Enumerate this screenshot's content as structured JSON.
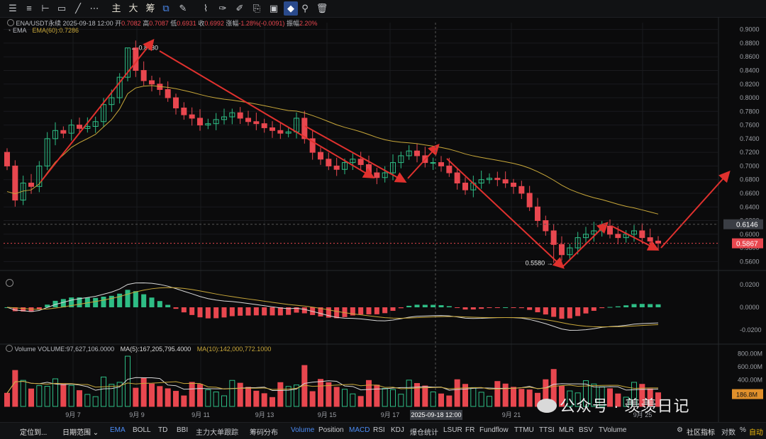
{
  "toolbar": {
    "text_tools": [
      "主",
      "大",
      "筹"
    ],
    "icons": [
      "layers-icon",
      "indicator-list-icon",
      "crosshair-icon",
      "rectangle-icon",
      "trendline-icon",
      "more-dots-icon",
      "main-chart-icon",
      "big-order-icon",
      "chips-icon",
      "compare-icon",
      "draw-icon",
      "ruler-icon",
      "brush-icon",
      "text-tool-icon",
      "copy-icon",
      "settings-icon",
      "magnet-icon",
      "filter-icon",
      "trash-icon"
    ]
  },
  "header": {
    "symbol": "ENA/USDT永续",
    "datetime": "2025-09-18 12:00",
    "open_label": "开",
    "open": "0.7082",
    "high_label": "高",
    "high": "0.7087",
    "low_label": "低",
    "low": "0.6931",
    "close_label": "收",
    "close": "0.6992",
    "change_label": "涨幅",
    "change": "-1.28%(-0.0091)",
    "amp_label": "振幅",
    "amp": "2.20%",
    "ema_title": "EMA",
    "ema_value": "EMA(60):0.7286"
  },
  "volume_legend": {
    "volume": "Volume",
    "volume_value": "VOLUME:97,627,106.0000",
    "ma5": "MA(5):167,205,795.4000",
    "ma10": "MA(10):142,000,772.1000"
  },
  "bottombar": {
    "left_btn": "定位到...",
    "range": "日期范围",
    "main_indicators": [
      "EMA",
      "BOLL",
      "TD",
      "BBI",
      "主力大单跟踪",
      "筹码分布"
    ],
    "sub_indicators": [
      "Volume",
      "Position",
      "MACD",
      "RSI",
      "KDJ",
      "爆仓统计",
      "LSUR",
      "FR",
      "Fundflow",
      "TTMU",
      "TTSI",
      "MLR",
      "BSV",
      "TVolume"
    ],
    "right_items": [
      "社区指标",
      "对数",
      "%",
      "自动"
    ]
  },
  "watermark": "公众号 · 羡羡日记",
  "colors": {
    "up": "#2ebd85",
    "down": "#e8474f",
    "ema": "#c9a83a",
    "arrow": "#e0312e",
    "macd_line": "#d9d9d9",
    "signal_line": "#c9a83a",
    "ma5": "#d9d9d9",
    "ma10": "#c9a83a",
    "accent": "#f0b90b"
  },
  "chart_data": {
    "type": "candlestick",
    "x_tick_labels": [
      "9月 7",
      "9月 9",
      "9月 11",
      "9月 13",
      "9月 15",
      "9月 17",
      "9月 21",
      "9月 25"
    ],
    "crosshair_x_label": "2025-09-18 12:00",
    "price_axis": {
      "min": 0.55,
      "max": 0.91,
      "ticks": [
        "0.9000",
        "0.8800",
        "0.8600",
        "0.8400",
        "0.8200",
        "0.8000",
        "0.7800",
        "0.7600",
        "0.7400",
        "0.7200",
        "0.7000",
        "0.6800",
        "0.6600",
        "0.6400",
        "0.6200",
        "0.6000",
        "0.5800",
        "0.5600"
      ]
    },
    "price_badges": {
      "crosshair": "0.6146",
      "last": "0.5867"
    },
    "annotations": {
      "high": "0.8730",
      "low": "0.5580"
    },
    "close_path": [
      0.7,
      0.65,
      0.675,
      0.67,
      0.7,
      0.74,
      0.752,
      0.748,
      0.76,
      0.755,
      0.758,
      0.765,
      0.79,
      0.8,
      0.83,
      0.873,
      0.84,
      0.825,
      0.82,
      0.812,
      0.8,
      0.785,
      0.775,
      0.77,
      0.76,
      0.762,
      0.768,
      0.772,
      0.778,
      0.77,
      0.765,
      0.762,
      0.756,
      0.752,
      0.748,
      0.75,
      0.77,
      0.74,
      0.72,
      0.71,
      0.7,
      0.695,
      0.705,
      0.71,
      0.702,
      0.69,
      0.683,
      0.69,
      0.705,
      0.715,
      0.722,
      0.715,
      0.705,
      0.705,
      0.7,
      0.69,
      0.675,
      0.665,
      0.675,
      0.68,
      0.682,
      0.68,
      0.675,
      0.67,
      0.66,
      0.64,
      0.62,
      0.605,
      0.585,
      0.57,
      0.58,
      0.595,
      0.6,
      0.605,
      0.612,
      0.6,
      0.595,
      0.6,
      0.605,
      0.595,
      0.59,
      0.587
    ],
    "ema60": {
      "name": "EMA(60)",
      "last": 0.7286
    },
    "macd": {
      "axis_ticks": [
        "0.0200",
        "0.0000",
        "-0.0200"
      ],
      "range": [
        -0.03,
        0.03
      ]
    },
    "volume": {
      "axis_ticks": [
        "800.00M",
        "600.00M",
        "400.00M",
        "200.00M"
      ],
      "badge": "186.8M",
      "range": [
        0,
        900
      ]
    }
  }
}
